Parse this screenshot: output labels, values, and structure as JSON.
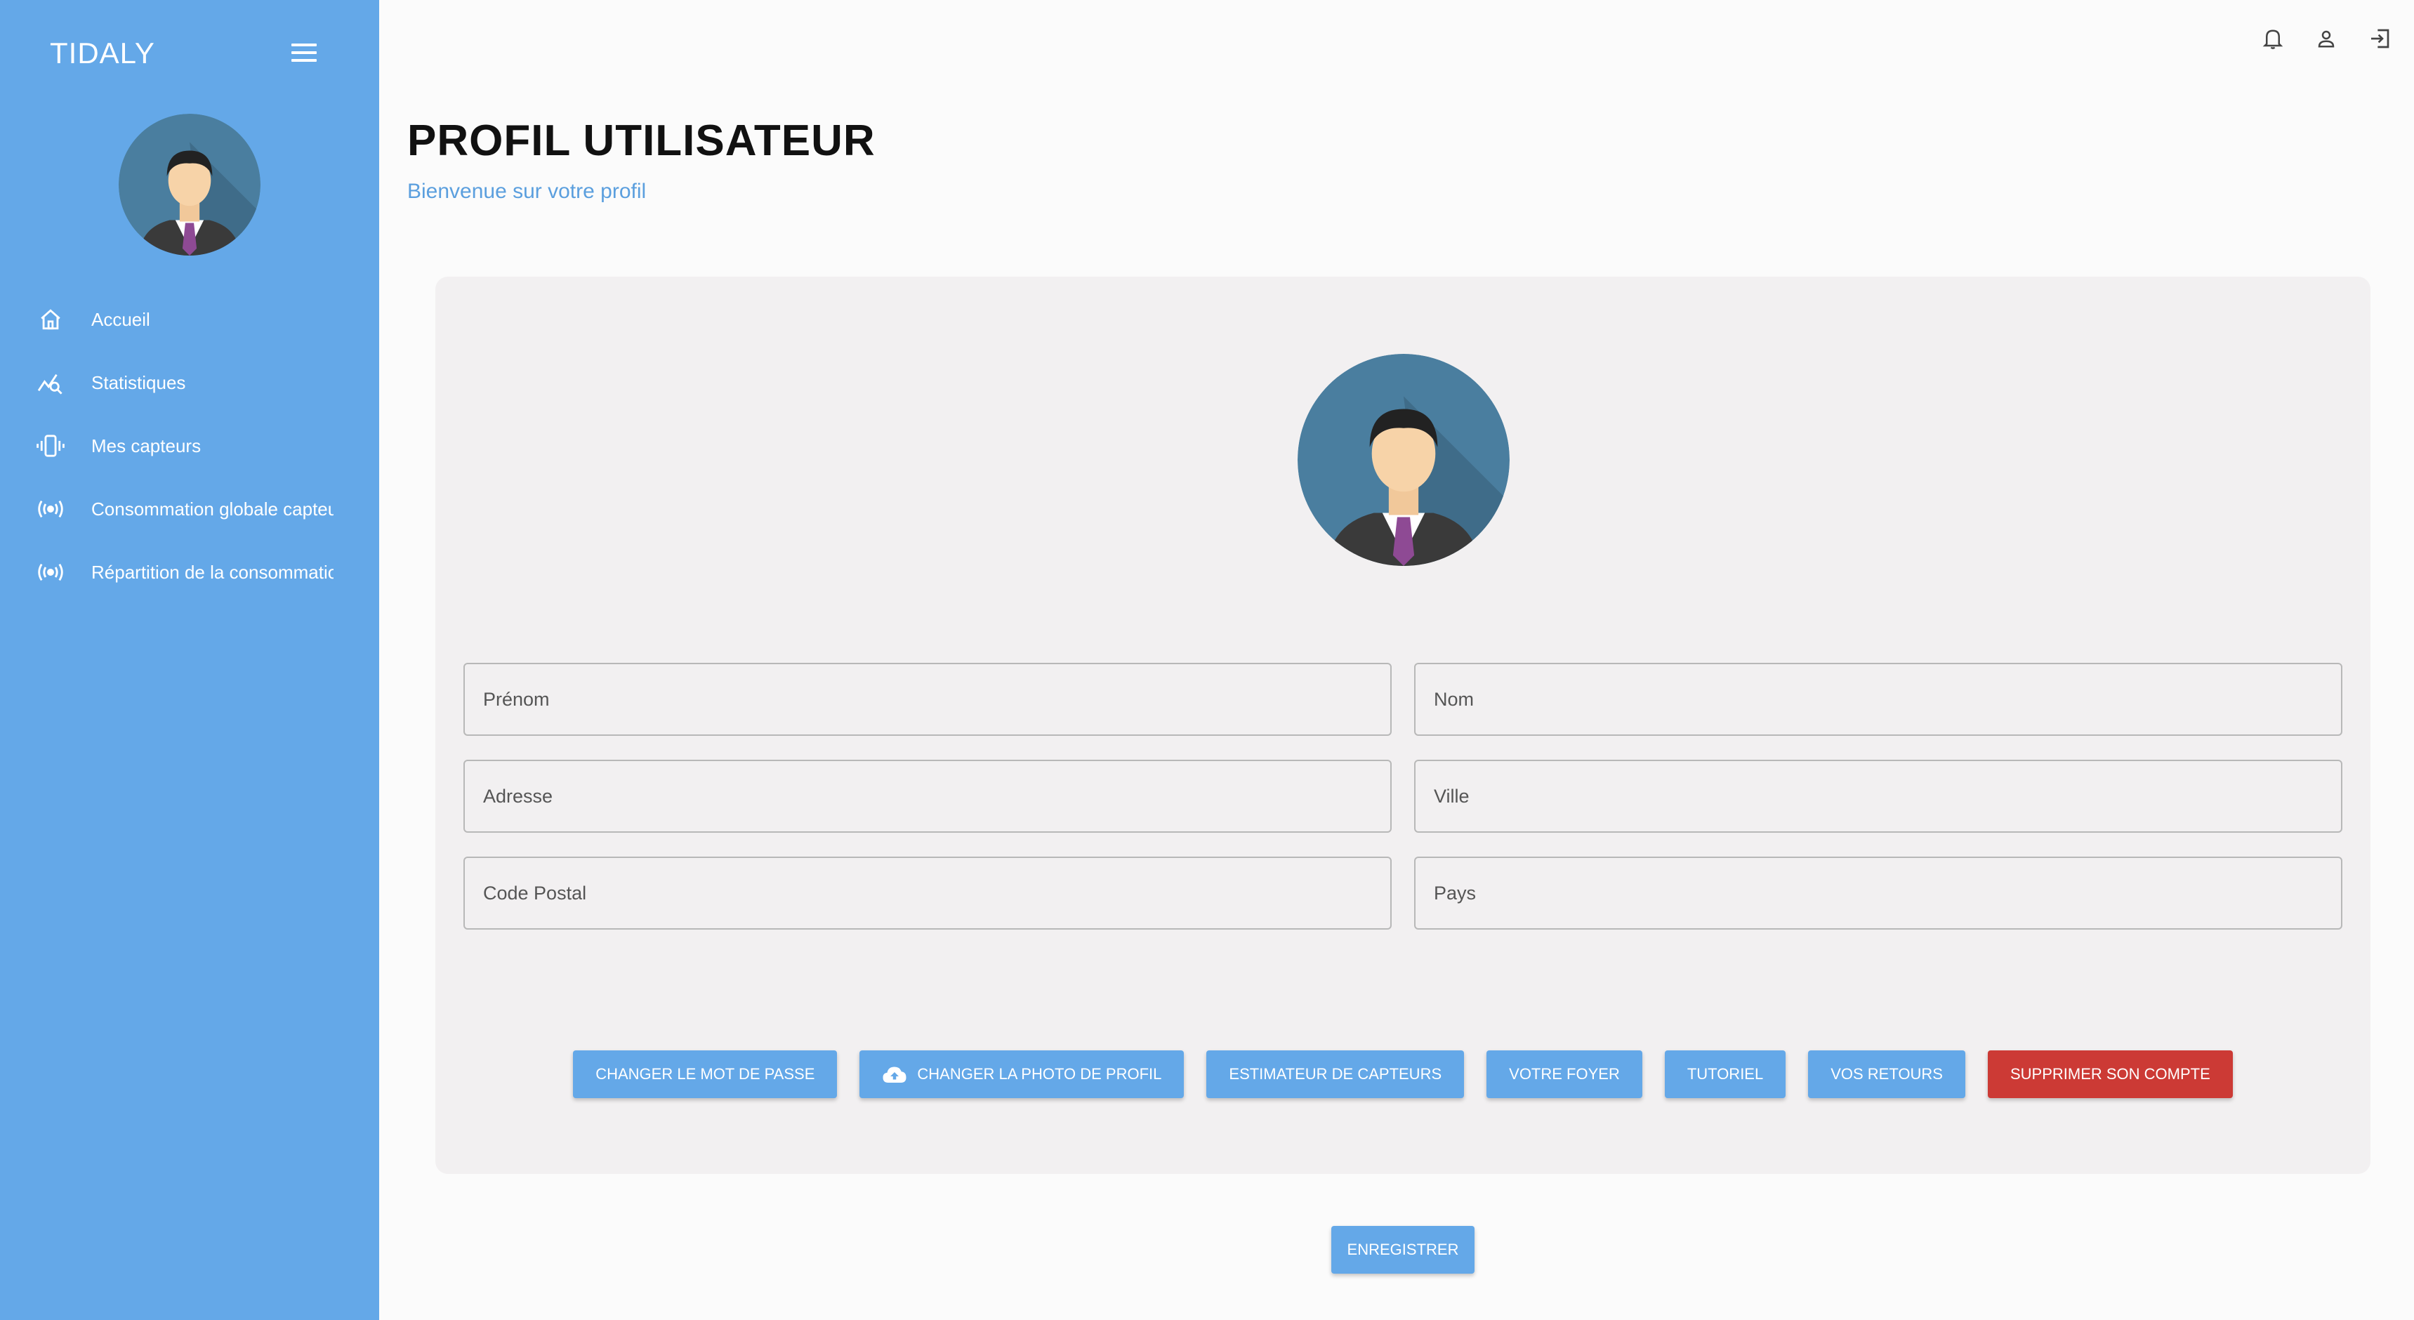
{
  "sidebar": {
    "brand": "TIDALY",
    "menu_icon": "hamburger-icon",
    "avatar_icon": "businessman-avatar",
    "items": [
      {
        "label": "Accueil",
        "icon": "home-icon"
      },
      {
        "label": "Statistiques",
        "icon": "chart-search-icon"
      },
      {
        "label": "Mes capteurs",
        "icon": "vibrating-device-icon"
      },
      {
        "label": "Consommation globale capteurs",
        "icon": "radio-signal-icon"
      },
      {
        "label": "Répartition de la consommation",
        "icon": "radio-signal-icon"
      }
    ]
  },
  "topbar": {
    "icons": [
      "bell-icon",
      "user-icon",
      "logout-icon"
    ]
  },
  "header": {
    "title": "PROFIL UTILISATEUR",
    "subtitle": "Bienvenue sur votre profil"
  },
  "form": {
    "first_name": {
      "value": "",
      "placeholder": "Prénom"
    },
    "last_name": {
      "value": "",
      "placeholder": "Nom"
    },
    "address": {
      "value": "",
      "placeholder": "Adresse"
    },
    "city": {
      "value": "",
      "placeholder": "Ville"
    },
    "postal_code": {
      "value": "",
      "placeholder": "Code Postal"
    },
    "country": {
      "value": "",
      "placeholder": "Pays"
    }
  },
  "actions": {
    "change_password": "CHANGER LE MOT DE PASSE",
    "change_photo": "CHANGER LA PHOTO DE PROFIL",
    "sensor_estimator": "ESTIMATEUR DE CAPTEURS",
    "your_home": "VOTRE FOYER",
    "tutorial": "TUTORIEL",
    "feedback": "VOS RETOURS",
    "delete_account": "SUPPRIMER SON COMPTE"
  },
  "save_label": "ENREGISTRER",
  "colors": {
    "primary": "#64a8e8",
    "danger": "#cc3a35",
    "card_bg": "#f2f0f1",
    "page_bg": "#fbfbfb"
  }
}
